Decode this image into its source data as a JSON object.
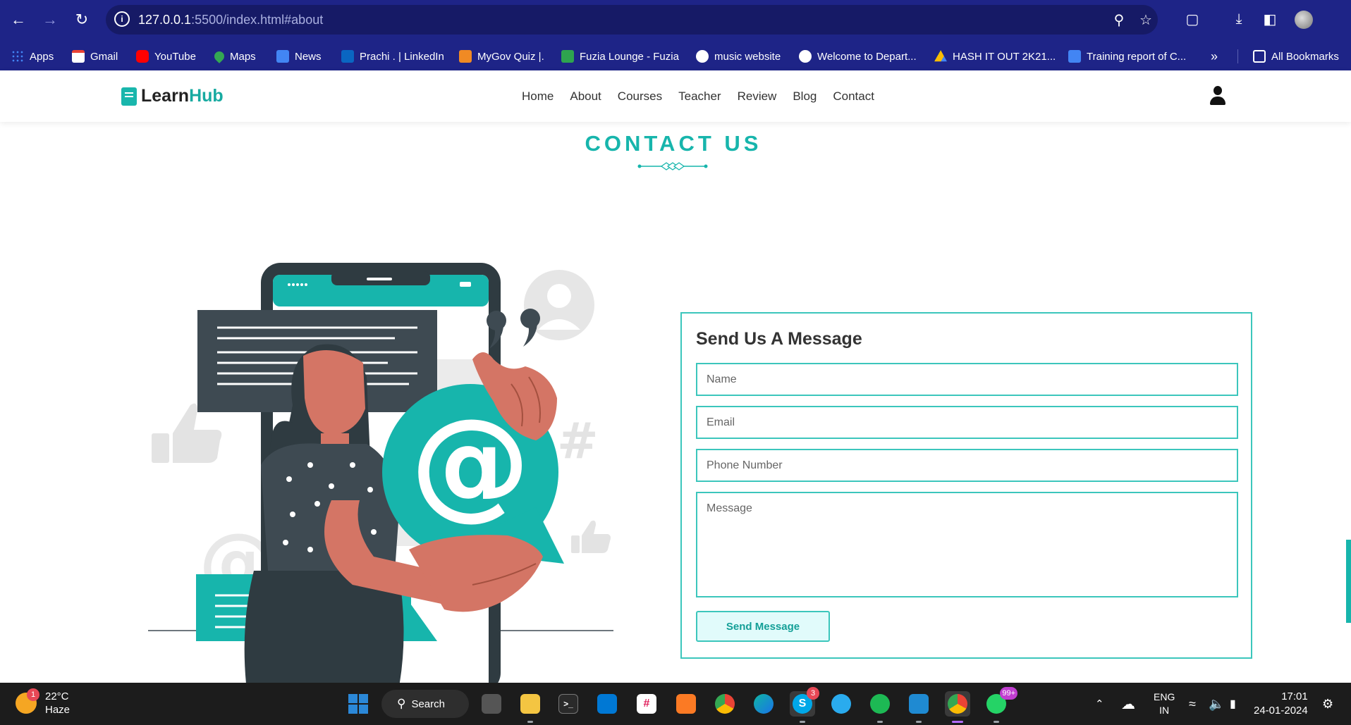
{
  "browser": {
    "url_host": "127.0.0.1",
    "url_rest": ":5500/index.html#about",
    "bookmarks": [
      {
        "label": "Apps",
        "color": "#4285f4"
      },
      {
        "label": "Gmail",
        "color": "#ea4335"
      },
      {
        "label": "YouTube",
        "color": "#ff0000"
      },
      {
        "label": "Maps",
        "color": "#34a853"
      },
      {
        "label": "News",
        "color": "#4285f4"
      },
      {
        "label": "Prachi . | LinkedIn",
        "color": "#0a66c2"
      },
      {
        "label": "MyGov Quiz |.",
        "color": "#f08a24"
      },
      {
        "label": "Fuzia Lounge - Fuzia",
        "color": "#2ea44f"
      },
      {
        "label": "music website",
        "color": "#ffffff"
      },
      {
        "label": "Welcome to Depart...",
        "color": "#ffffff"
      },
      {
        "label": "HASH IT OUT 2K21...",
        "color": "#fbbc04"
      },
      {
        "label": "Training report of C...",
        "color": "#4285f4"
      }
    ],
    "all_bookmarks": "All Bookmarks"
  },
  "site": {
    "logo_part1": "Learn",
    "logo_part2": "Hub",
    "nav": [
      "Home",
      "About",
      "Courses",
      "Teacher",
      "Review",
      "Blog",
      "Contact"
    ]
  },
  "contact": {
    "heading": "CONTACT US",
    "form_title": "Send Us A Message",
    "placeholders": {
      "name": "Name",
      "email": "Email",
      "phone": "Phone Number",
      "message": "Message"
    },
    "button": "Send Message"
  },
  "taskbar": {
    "temperature": "22°C",
    "condition": "Haze",
    "weather_badge": "1",
    "search": "Search",
    "skype_badge": "3",
    "whatsapp_badge": "99+",
    "lang1": "ENG",
    "lang2": "IN",
    "time": "17:01",
    "date": "24-01-2024"
  },
  "colors": {
    "accent": "#17b5ac",
    "browser_chrome": "#1e2487",
    "dark_slate": "#3e4a52"
  }
}
